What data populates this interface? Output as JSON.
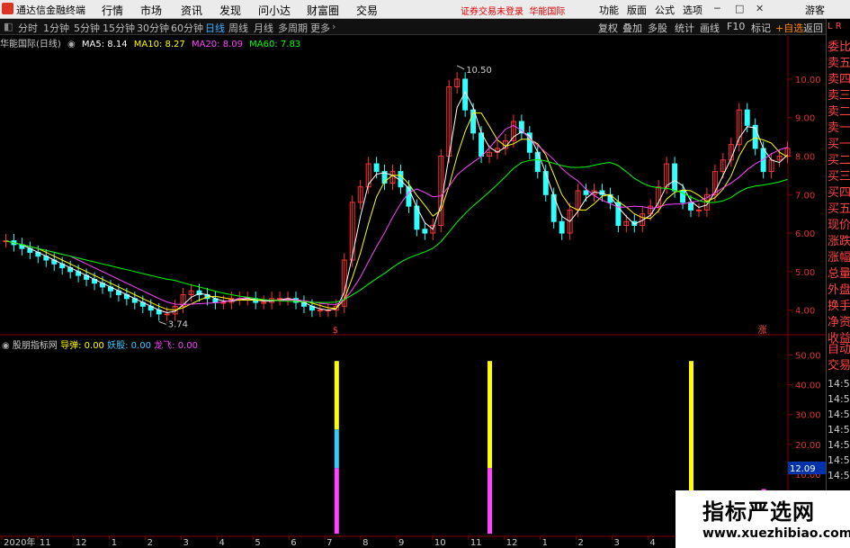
{
  "app": {
    "title": "通达信金融终端",
    "warning": "证券交易未登录",
    "stock_name": "华能国际"
  },
  "menu": [
    "行情",
    "市场",
    "资讯",
    "发现",
    "问小达",
    "财富圈",
    "交易"
  ],
  "right_menu": [
    "功能",
    "版面",
    "公式",
    "选项",
    "游客"
  ],
  "period_tabs": [
    "分时",
    "1分钟",
    "5分钟",
    "15分钟",
    "30分钟",
    "60分钟",
    "日线",
    "周线",
    "月线",
    "多周期",
    "更多"
  ],
  "active_period": 6,
  "right_tools": [
    "复权",
    "叠加",
    "多股",
    "统计",
    "画线",
    "F10",
    "标记",
    "+自选",
    "返回"
  ],
  "legend_main": {
    "title": "华能国际(日线)",
    "items": [
      {
        "label": "MA5: 8.14",
        "color": "#ffffff"
      },
      {
        "label": "MA10: 8.27",
        "color": "#ffff00"
      },
      {
        "label": "MA20: 8.09",
        "color": "#ff44ff"
      },
      {
        "label": "MA60: 7.83",
        "color": "#00ff00"
      }
    ]
  },
  "legend_indicator": {
    "title": "股朋指标网",
    "items": [
      {
        "label": "导弹: 0.00",
        "color": "#ffff00"
      },
      {
        "label": "妖股: 0.00",
        "color": "#33ccff"
      },
      {
        "label": "龙飞: 0.00",
        "color": "#ff44ff"
      }
    ]
  },
  "price_axis": [
    "10.00",
    "9.00",
    "8.00",
    "7.00",
    "6.00",
    "5.00",
    "4.00"
  ],
  "indicator_axis": [
    "50.00",
    "40.00",
    "30.00",
    "20.00",
    "10.00",
    "0.00"
  ],
  "indicator_current": "12.09",
  "price_high_label": "10.50",
  "price_low_label": "3.74",
  "time_axis": [
    "2020年",
    "11",
    "12",
    "1",
    "2",
    "3",
    "4",
    "5",
    "6",
    "7",
    "8",
    "9",
    "10",
    "11",
    "12",
    "1",
    "2",
    "3",
    "4",
    "5",
    "6",
    "7"
  ],
  "right_panel_labels": [
    "委比",
    "卖五",
    "卖四",
    "卖三",
    "卖二",
    "卖一",
    "买一",
    "买二",
    "买三",
    "买四",
    "买五",
    "现价",
    "涨跌",
    "涨幅",
    "总量",
    "外盘",
    "换手",
    "净资",
    "收益",
    "自动",
    "交易"
  ],
  "right_panel_times": [
    "14:56",
    "14:56",
    "14:56",
    "14:56",
    "14:56",
    "14:56",
    "14:56"
  ],
  "right_panel_top": "L R",
  "signal_marks": [
    "$",
    "涨"
  ],
  "watermark": {
    "line1": "指标严选网",
    "line2": "www.xuezhibiao.com"
  },
  "chart_data": {
    "type": "candlestick",
    "price_range": [
      3.5,
      10.7
    ],
    "close": [
      5.8,
      5.7,
      5.6,
      5.5,
      5.4,
      5.3,
      5.2,
      5.1,
      5.0,
      4.9,
      4.8,
      4.7,
      4.6,
      4.5,
      4.4,
      4.3,
      4.2,
      4.1,
      4.0,
      3.9,
      3.9,
      4.1,
      4.4,
      4.5,
      4.4,
      4.3,
      4.2,
      4.2,
      4.3,
      4.3,
      4.3,
      4.2,
      4.2,
      4.3,
      4.3,
      4.3,
      4.2,
      4.1,
      4.0,
      4.0,
      4.0,
      4.1,
      5.3,
      6.8,
      7.2,
      7.8,
      7.6,
      7.3,
      7.6,
      7.2,
      6.7,
      6.1,
      6.0,
      6.2,
      8.0,
      9.8,
      10.0,
      9.2,
      8.6,
      8.0,
      8.1,
      8.2,
      8.4,
      8.9,
      8.6,
      8.1,
      7.6,
      7.0,
      6.3,
      6.0,
      6.6,
      7.1,
      7.0,
      7.1,
      7.0,
      6.8,
      6.2,
      6.3,
      6.2,
      6.5,
      6.7,
      7.2,
      7.8,
      7.1,
      6.8,
      6.6,
      6.6,
      7.0,
      7.6,
      7.9,
      8.3,
      9.2,
      8.8,
      8.2,
      7.6,
      7.9,
      8.0,
      8.2
    ],
    "ma_summary": {
      "MA5": 8.14,
      "MA10": 8.27,
      "MA20": 8.09,
      "MA60": 7.83
    },
    "indicator_range": [
      0,
      55
    ],
    "indicator_bars": [
      {
        "index": 41,
        "series": "导弹",
        "value": 48
      },
      {
        "index": 41,
        "series": "妖股",
        "value": 25
      },
      {
        "index": 41,
        "series": "龙飞",
        "value": 12
      },
      {
        "index": 60,
        "series": "导弹",
        "value": 48
      },
      {
        "index": 60,
        "series": "龙飞",
        "value": 12
      },
      {
        "index": 85,
        "series": "导弹",
        "value": 48
      },
      {
        "index": 94,
        "series": "龙飞",
        "value": 5
      }
    ]
  }
}
